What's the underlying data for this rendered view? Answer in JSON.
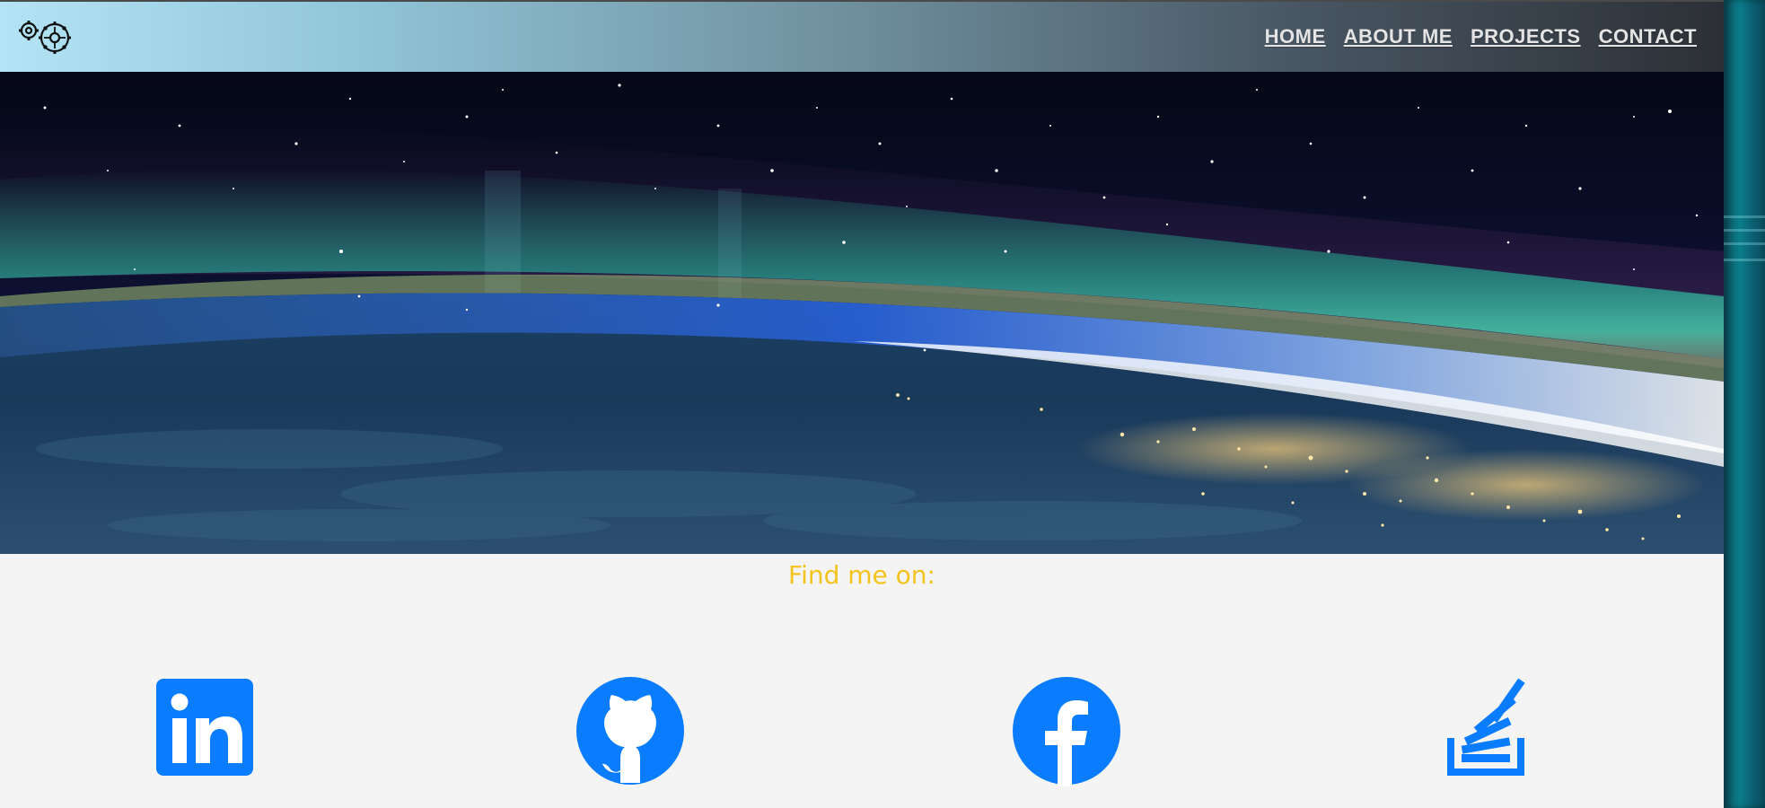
{
  "nav": {
    "logo": "gears-logo-icon",
    "links": [
      "HOME",
      "ABOUT ME",
      "PROJECTS",
      "CONTACT"
    ]
  },
  "hero": {
    "image": "earth-aurora-from-space"
  },
  "social": {
    "heading": "Find me on:",
    "icons": [
      "linkedin-icon",
      "github-icon",
      "facebook-icon",
      "stackoverflow-icon"
    ]
  },
  "colors": {
    "heading": "#f3c31e",
    "icon_blue": "#0a7cff",
    "nav_text": "#e4e4e4"
  }
}
